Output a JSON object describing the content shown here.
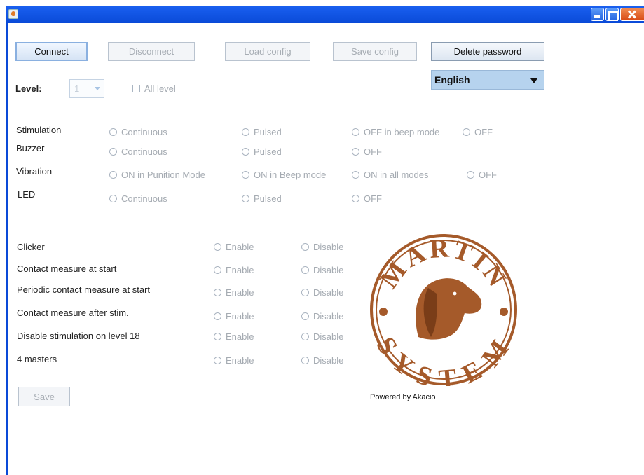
{
  "toolbar": {
    "connect": "Connect",
    "disconnect": "Disconnect",
    "load_config": "Load config",
    "save_config": "Save config",
    "delete_password": "Delete password"
  },
  "language": {
    "selected": "English"
  },
  "level": {
    "label": "Level:",
    "value": "1",
    "all_level": "All level"
  },
  "modes": {
    "stimulation": {
      "label": "Stimulation",
      "options": [
        "Continuous",
        "Pulsed",
        "OFF in beep mode",
        "OFF"
      ]
    },
    "buzzer": {
      "label": "Buzzer",
      "options": [
        "Continuous",
        "Pulsed",
        "OFF"
      ]
    },
    "vibration": {
      "label": "Vibration",
      "options": [
        "ON in Punition Mode",
        "ON in Beep mode",
        "ON in all modes",
        "OFF"
      ]
    },
    "led": {
      "label": "LED",
      "options": [
        "Continuous",
        "Pulsed",
        "OFF"
      ]
    }
  },
  "features": {
    "enable": "Enable",
    "disable": "Disable",
    "rows": [
      "Clicker",
      "Contact measure at start",
      "Periodic contact measure at start",
      "Contact measure after stim.",
      "Disable stimulation on level 18",
      "4 masters"
    ]
  },
  "save": "Save",
  "logo": {
    "top_text": "MARTIN",
    "bottom_text": "SYSTEM"
  },
  "powered_by": "Powered by Akacio",
  "colors": {
    "titlebar": "#0a4ad8",
    "logo_brown": "#a55a2a",
    "language_bg": "#b6d3ee"
  }
}
